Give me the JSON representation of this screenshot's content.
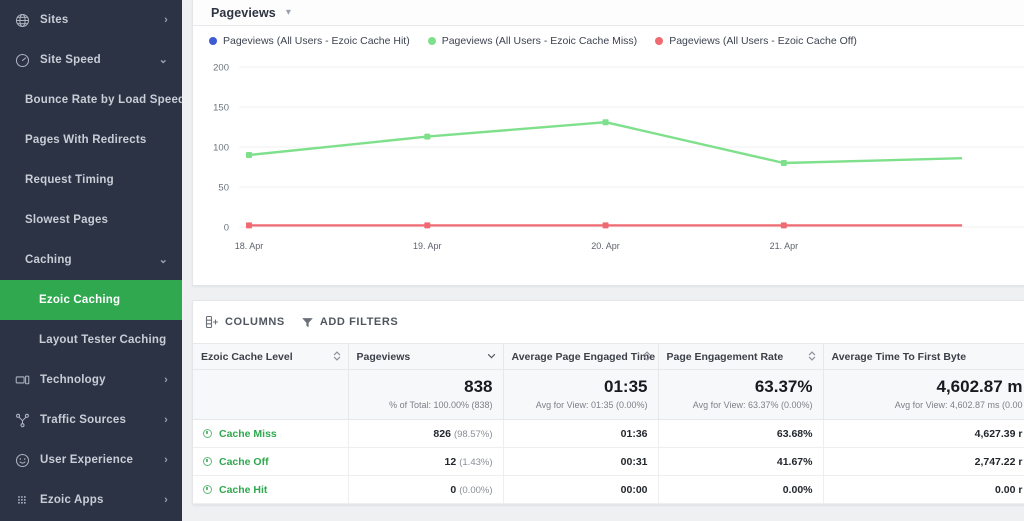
{
  "sidebar": {
    "items": [
      {
        "label": "Sites",
        "icon": "globe-icon",
        "caret": "chevron-right",
        "level": 0,
        "active": false
      },
      {
        "label": "Site Speed",
        "icon": "speedometer-icon",
        "caret": "chevron-down",
        "level": 0,
        "active": false
      },
      {
        "label": "Bounce Rate by Load Speed",
        "icon": "",
        "caret": "",
        "level": 1,
        "active": false
      },
      {
        "label": "Pages With Redirects",
        "icon": "",
        "caret": "",
        "level": 1,
        "active": false
      },
      {
        "label": "Request Timing",
        "icon": "",
        "caret": "",
        "level": 1,
        "active": false
      },
      {
        "label": "Slowest Pages",
        "icon": "",
        "caret": "",
        "level": 1,
        "active": false
      },
      {
        "label": "Caching",
        "icon": "",
        "caret": "chevron-down",
        "level": 1,
        "active": false
      },
      {
        "label": "Ezoic Caching",
        "icon": "",
        "caret": "",
        "level": 2,
        "active": true
      },
      {
        "label": "Layout Tester Caching",
        "icon": "",
        "caret": "",
        "level": 2,
        "active": false
      },
      {
        "label": "Technology",
        "icon": "device-icon",
        "caret": "chevron-right",
        "level": 0,
        "active": false
      },
      {
        "label": "Traffic Sources",
        "icon": "share-nodes-icon",
        "caret": "chevron-right",
        "level": 0,
        "active": false
      },
      {
        "label": "User Experience",
        "icon": "smiley-icon",
        "caret": "chevron-right",
        "level": 0,
        "active": false
      },
      {
        "label": "Ezoic Apps",
        "icon": "grid-dots-icon",
        "caret": "chevron-right",
        "level": 0,
        "active": false
      }
    ],
    "active_color": "#2fa84f",
    "background_color": "#2b3344"
  },
  "chart_header": {
    "metric_label": "Pageviews",
    "caret": "chevron-down"
  },
  "chart_data": {
    "type": "line",
    "title": "Pageviews",
    "xlabel": "",
    "ylabel": "",
    "x": [
      "18. Apr",
      "19. Apr",
      "20. Apr",
      "21. Apr"
    ],
    "ylim": [
      0,
      200
    ],
    "yticks": [
      0,
      50,
      100,
      150,
      200
    ],
    "grid": true,
    "legend_position": "top-left",
    "series": [
      {
        "name": "Pageviews (All Users - Ezoic Cache Hit)",
        "color": "#3f5bd6",
        "values": [
          0,
          0,
          0,
          0,
          0
        ]
      },
      {
        "name": "Pageviews (All Users - Ezoic Cache Miss)",
        "color": "#7fe08c",
        "values": [
          90,
          113,
          131,
          80,
          86
        ]
      },
      {
        "name": "Pageviews (All Users - Ezoic Cache Off)",
        "color": "#f06a72",
        "values": [
          2,
          2,
          2,
          2,
          2
        ]
      }
    ]
  },
  "table": {
    "toolbar": {
      "columns_label": "COLUMNS",
      "columns_icon": "columns-add-icon",
      "filters_label": "ADD FILTERS",
      "filters_icon": "funnel-icon"
    },
    "columns": [
      {
        "label": "Ezoic Cache Level",
        "sorter": "sort-updown-icon"
      },
      {
        "label": "Pageviews",
        "sorter": "chevron-down-icon"
      },
      {
        "label": "Average Page Engaged Time",
        "sorter": "sort-updown-icon"
      },
      {
        "label": "Page Engagement Rate",
        "sorter": "sort-updown-icon"
      },
      {
        "label": "Average Time To First Byte",
        "sorter": ""
      }
    ],
    "summary": [
      {
        "value": "",
        "sub": ""
      },
      {
        "value": "838",
        "sub": "% of Total: 100.00%  (838)"
      },
      {
        "value": "01:35",
        "sub": "Avg for View: 01:35  (0.00%)"
      },
      {
        "value": "63.37%",
        "sub": "Avg for View: 63.37%  (0.00%)"
      },
      {
        "value": "4,602.87 m",
        "sub": "Avg for View: 4,602.87 ms  (0.00"
      }
    ],
    "rows": [
      {
        "level": "Cache Miss",
        "pageviews": "826",
        "pageviews_pct": "(98.57%)",
        "engaged_time": "01:36",
        "engagement_rate": "63.68%",
        "ttfb": "4,627.39 r"
      },
      {
        "level": "Cache Off",
        "pageviews": "12",
        "pageviews_pct": "(1.43%)",
        "engaged_time": "00:31",
        "engagement_rate": "41.67%",
        "ttfb": "2,747.22 r"
      },
      {
        "level": "Cache Hit",
        "pageviews": "0",
        "pageviews_pct": "(0.00%)",
        "engaged_time": "00:00",
        "engagement_rate": "0.00%",
        "ttfb": "0.00 r"
      }
    ]
  }
}
